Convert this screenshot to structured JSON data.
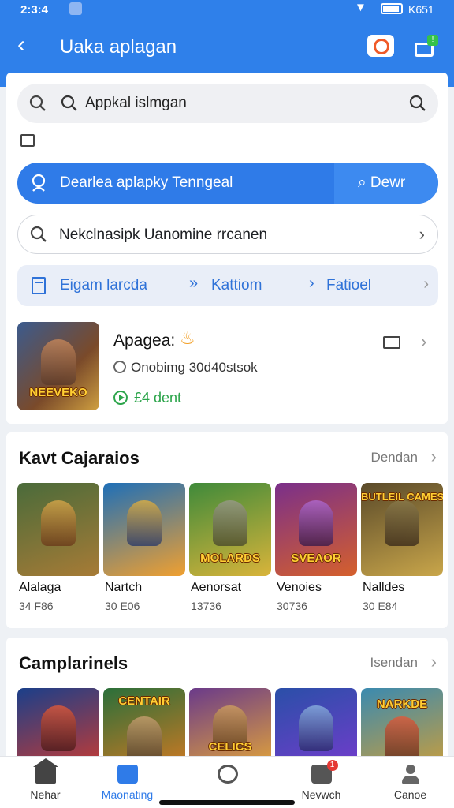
{
  "status_bar": {
    "time": "2:3:4",
    "battery_text": "K651"
  },
  "header": {
    "title": "Uaka aplagan"
  },
  "search": {
    "value": "Appkal islmgan"
  },
  "primary_action": {
    "label": "Dearlea aplapky Tenngeal",
    "secondary_label": "Dewr"
  },
  "secondary_search": {
    "label": "Nekclnasipk Uanomine rrcanen"
  },
  "chips": [
    {
      "label": "Eigam larcda"
    },
    {
      "label": "Kattiom"
    },
    {
      "label": "Fatioel"
    }
  ],
  "featured": {
    "name": "Apagea:",
    "meta": "Onobimg 30d40stsok",
    "download": "£4 dent",
    "art_text": "NEEVEKO"
  },
  "section1": {
    "title": "Kavt Cajaraios",
    "more": "Dendan",
    "games": [
      {
        "name": "Alalaga",
        "count": "34 F86",
        "art": "",
        "c1": "#4a6b3a",
        "c2": "#a77b36"
      },
      {
        "name": "Nartch",
        "count": "30 E06",
        "art": "",
        "c1": "#1e6fb8",
        "c2": "#f0a030"
      },
      {
        "name": "Aenorsat",
        "count": "13736",
        "art": "MOLARDS",
        "c1": "#3f8a3a",
        "c2": "#d9b43a"
      },
      {
        "name": "Venoies",
        "count": "30736",
        "art": "SVEAOR",
        "c1": "#7a2f8a",
        "c2": "#d5602c"
      },
      {
        "name": "Nalldes",
        "count": "30 E84",
        "art": "BUTLEIL CAMES",
        "c1": "#5a4a2a",
        "c2": "#c9a64a"
      }
    ]
  },
  "section2": {
    "title": "Camplarinels",
    "more": "Isendan",
    "games": [
      {
        "art": "",
        "c1": "#1a3f8a",
        "c2": "#d83a2a"
      },
      {
        "art": "CENTAIR",
        "c1": "#2a6f3a",
        "c2": "#e07a20"
      },
      {
        "art": "CELICS",
        "c1": "#6a3a8a",
        "c2": "#f0b030"
      },
      {
        "art": "",
        "c1": "#2a4fa8",
        "c2": "#7a3ad0"
      },
      {
        "art": "NARKDE",
        "c1": "#3a8ab0",
        "c2": "#d8a030"
      }
    ]
  },
  "bottom_nav": [
    {
      "label": "Nehar",
      "icon": "home-icon"
    },
    {
      "label": "Maonating",
      "icon": "meeting-icon"
    },
    {
      "label": "",
      "icon": "ball-icon"
    },
    {
      "label": "Nevwch",
      "icon": "messages-icon",
      "badge": "1"
    },
    {
      "label": "Canoe",
      "icon": "user-icon"
    }
  ]
}
